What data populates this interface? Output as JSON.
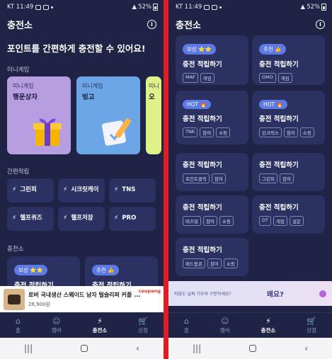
{
  "colors": {
    "background": "#1f2447",
    "card": "#2b3160",
    "badge": "#5c79e6",
    "divider": "#e31b23",
    "game_purple": "#b69ee0",
    "game_blue": "#6da6e6",
    "game_lime": "#dff28a"
  },
  "status": {
    "carrier_time": "KT 11:49",
    "battery": "52%"
  },
  "left": {
    "title": "충전소",
    "headline": "포인트를 간편하게 충전할 수 있어요!",
    "minigame_label": "미니게임",
    "games": [
      {
        "small": "미니게임",
        "name": "행운상자",
        "icon": "gift-box-icon"
      },
      {
        "small": "미니게임",
        "name": "빙고",
        "icon": "bingo-pencil-icon"
      },
      {
        "small": "미니게임",
        "name": "오"
      }
    ],
    "easy_label": "간편적립",
    "chips": [
      {
        "label": "그린피"
      },
      {
        "label": "시크릿케이"
      },
      {
        "label": "TNS"
      },
      {
        "label": "헬프퀴즈"
      },
      {
        "label": "헬프저장"
      },
      {
        "label": "PRO"
      }
    ],
    "charge_label": "충전소",
    "charge_cards": [
      {
        "badge": "보상 ⭐⭐",
        "title": "충전 적립하기"
      },
      {
        "badge": "추천 👍",
        "title": "충전 적립하기"
      }
    ],
    "ad": {
      "title": "로버 국내생산 스웨이드 남자 털슬리퍼 커플 ...",
      "price": "26,900원",
      "brand": "coupang"
    }
  },
  "right": {
    "title": "충전소",
    "cards": [
      {
        "badge": "보상 ⭐⭐",
        "title": "충전 적립하기",
        "tags": [
          "MAF",
          "게임"
        ]
      },
      {
        "badge": "추천 👍",
        "title": "충전 적립하기",
        "tags": [
          "GMO",
          "게임"
        ]
      },
      {
        "badge": "HOT 🔥",
        "title": "충전 적립하기",
        "tags": [
          "TNK",
          "참여",
          "쇼핑"
        ]
      },
      {
        "badge": "HOT 🔥",
        "title": "충전 적립하기",
        "tags": [
          "린크럭스",
          "참여",
          "쇼핑"
        ]
      },
      {
        "badge": "",
        "title": "충전 적립하기",
        "tags": [
          "포인트클릭",
          "참여"
        ]
      },
      {
        "badge": "",
        "title": "충전 적립하기",
        "tags": [
          "그린피",
          "참여"
        ]
      },
      {
        "badge": "",
        "title": "충전 적립하기",
        "tags": [
          "버즈빌",
          "참여",
          "쇼핑"
        ]
      },
      {
        "badge": "",
        "title": "충전 적립하기",
        "tags": [
          "DT",
          "게임",
          "설문"
        ]
      },
      {
        "badge": "",
        "title": "충전 적립하기",
        "tags": [
          "애드팝콘",
          "참여",
          "쇼핑"
        ]
      }
    ],
    "ad": {
      "text": "마음도 날짜 기부라 구분하세요?",
      "big": "왜요?"
    }
  },
  "nav": [
    {
      "label": "홈",
      "icon": "home-icon"
    },
    {
      "label": "멤버",
      "icon": "members-icon"
    },
    {
      "label": "충전소",
      "icon": "bolt-icon",
      "active": true
    },
    {
      "label": "상점",
      "icon": "cart-icon"
    }
  ]
}
